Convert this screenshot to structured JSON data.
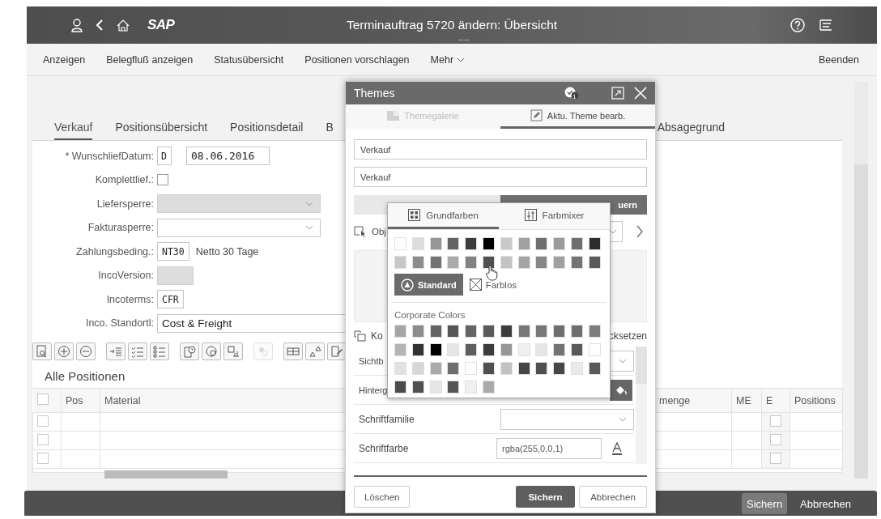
{
  "shell": {
    "logo": "SAP",
    "title": "Terminauftrag 5720 ändern: Übersicht"
  },
  "actions": {
    "items": [
      "Anzeigen",
      "Belegfluß anzeigen",
      "Statusübersicht",
      "Positionen vorschlagen"
    ],
    "more": "Mehr",
    "exit": "Beenden"
  },
  "tabs": [
    {
      "label": "Verkauf",
      "selected": true
    },
    {
      "label": "Positionsübersicht",
      "selected": false
    },
    {
      "label": "Positionsdetail",
      "selected": false
    },
    {
      "label": "B",
      "selected": false
    },
    {
      "label": "Absagegrund",
      "selected": false
    }
  ],
  "form": [
    {
      "label": "* WunschliefDatum:",
      "kind": "date",
      "prefix": "D",
      "value": "08.06.2016"
    },
    {
      "label": "Komplettlief.:",
      "kind": "checkbox",
      "checked": false
    },
    {
      "label": "Liefersperre:",
      "kind": "select",
      "disabled": true
    },
    {
      "label": "Fakturasperre:",
      "kind": "select",
      "disabled": false
    },
    {
      "label": "Zahlungsbeding.:",
      "kind": "code",
      "value": "NT30",
      "description": "Netto 30 Tage"
    },
    {
      "label": "IncoVersion:",
      "kind": "empty",
      "disabled": true
    },
    {
      "label": "Incoterms:",
      "kind": "code",
      "value": "CFR"
    },
    {
      "label": "Inco. Standortl:",
      "kind": "text",
      "value": "Cost & Freight"
    }
  ],
  "toolbar_buttons": [
    {
      "disabled": false
    },
    {
      "disabled": false
    },
    {
      "disabled": false
    },
    {
      "disabled": false
    },
    {
      "disabled": false
    },
    {
      "disabled": false
    },
    {
      "disabled": false
    },
    {
      "disabled": false
    },
    {
      "disabled": false
    },
    {
      "disabled": true
    },
    {
      "disabled": false
    },
    {
      "disabled": false
    },
    {
      "disabled": false
    }
  ],
  "items_title": "Alle Positionen",
  "table": {
    "all_selected": false,
    "columns": [
      {
        "label": "Pos",
        "kind": "pos"
      },
      {
        "label": "Material",
        "kind": "material"
      },
      {
        "label": "menge",
        "kind": "qty"
      },
      {
        "label": "ME",
        "kind": "unit"
      },
      {
        "label": "E",
        "kind": "check"
      },
      {
        "label": "Positions",
        "kind": "type"
      }
    ],
    "rows": [
      {
        "selected": false,
        "e_checked": false
      },
      {
        "selected": false,
        "e_checked": false
      },
      {
        "selected": false,
        "e_checked": false
      }
    ]
  },
  "footer": {
    "buttons": [
      {
        "label": "Sichern",
        "kind": "primary"
      },
      {
        "label": "Abbrechen",
        "kind": "plain"
      }
    ]
  },
  "dialog": {
    "title": "Themes",
    "badge": "1",
    "tabs": [
      {
        "label": "Themegalerie",
        "selected": false,
        "disabled": true
      },
      {
        "label": "Aktu. Theme bearb.",
        "selected": true,
        "disabled": false
      }
    ],
    "name": "Verkauf",
    "description": "Verkauf",
    "segments": [
      {
        "selected": false
      },
      {
        "label": "uern",
        "selected": true
      }
    ],
    "object_label": "Obj",
    "copy_label": "Ko",
    "reset_label": "cksetzen",
    "properties": [
      {
        "label": "Sichtb",
        "kind": "select"
      },
      {
        "label": "Hinterg",
        "kind": "color-button"
      },
      {
        "label": "Schriftfamilie",
        "kind": "select"
      },
      {
        "label": "Schriftfarbe",
        "kind": "color-input",
        "value": "rgba(255,0,0,1)"
      }
    ],
    "buttons": [
      {
        "label": "Löschen",
        "kind": "plain"
      },
      {
        "label": "Sichern",
        "kind": "primary"
      },
      {
        "label": "Abbrechen",
        "kind": "plain"
      }
    ]
  },
  "color_picker": {
    "tabs": [
      {
        "label": "Grundfarben",
        "selected": true
      },
      {
        "label": "Farbmixer",
        "selected": false
      }
    ],
    "basic_colors": [
      {
        "color": "#ffffff"
      },
      {
        "color": "#dcdcdc"
      },
      {
        "color": "#969696"
      },
      {
        "color": "#646464"
      },
      {
        "color": "#3c3c3c"
      },
      {
        "color": "#000000"
      },
      {
        "color": "#c8c8c8"
      },
      {
        "color": "#a0a0a0"
      },
      {
        "color": "#6e6e6e"
      },
      {
        "color": "#9b9b9b"
      },
      {
        "color": "#6e6e6e"
      },
      {
        "color": "#2d2d2d"
      },
      {
        "color": "#c8c8c8"
      },
      {
        "color": "#8c8c8c"
      },
      {
        "color": "#737373"
      },
      {
        "color": "#aaaaaa"
      },
      {
        "color": "#828282"
      },
      {
        "color": "#505050"
      },
      {
        "color": "#c3c3c3"
      },
      {
        "color": "#a5a5a5"
      },
      {
        "color": "#878787"
      },
      {
        "color": "#a0a0a0"
      },
      {
        "color": "#737373"
      },
      {
        "color": "#5a5a5a"
      }
    ],
    "standard": "Standard",
    "none": "Farblos",
    "corporate_title": "Corporate Colors",
    "corporate_colors": [
      {
        "color": "#a5a5a5"
      },
      {
        "color": "#8c8c8c"
      },
      {
        "color": "#646464"
      },
      {
        "color": "#555555"
      },
      {
        "color": "#646464"
      },
      {
        "color": "#5a5a5a"
      },
      {
        "color": "#3c3c3c"
      },
      {
        "color": "#787878"
      },
      {
        "color": "#787878"
      },
      {
        "color": "#6e6e6e"
      },
      {
        "color": "#6e6e6e"
      },
      {
        "color": "#7d7d7d"
      },
      {
        "color": "#b4b4b4"
      },
      {
        "color": "#323232"
      },
      {
        "color": "#000000"
      },
      {
        "color": "#e6e6e6"
      },
      {
        "color": "#5f5f5f"
      },
      {
        "color": "#3c3c3c"
      },
      {
        "color": "#969696"
      },
      {
        "color": "#f0f0f0"
      },
      {
        "color": "#e6e6e6"
      },
      {
        "color": "#737373"
      },
      {
        "color": "#5a5a5a"
      },
      {
        "color": "#ffffff"
      },
      {
        "color": "#e1e1e1"
      },
      {
        "color": "#d7d7d7"
      },
      {
        "color": "#aaaaaa"
      },
      {
        "color": "#6e6e6e"
      },
      {
        "color": "#ffffff"
      },
      {
        "color": "#505050"
      },
      {
        "color": "#c3c3c3"
      },
      {
        "color": "#464646"
      },
      {
        "color": "#505050"
      },
      {
        "color": "#464646"
      },
      {
        "color": "#ebebeb"
      },
      {
        "color": "#5a5a5a"
      },
      {
        "color": "#4b4b4b"
      },
      {
        "color": "#505050"
      },
      {
        "color": "#e6e6e6"
      },
      {
        "color": "#555555"
      },
      {
        "color": "#f0f0f0"
      },
      {
        "color": "#aaaaaa"
      }
    ]
  }
}
